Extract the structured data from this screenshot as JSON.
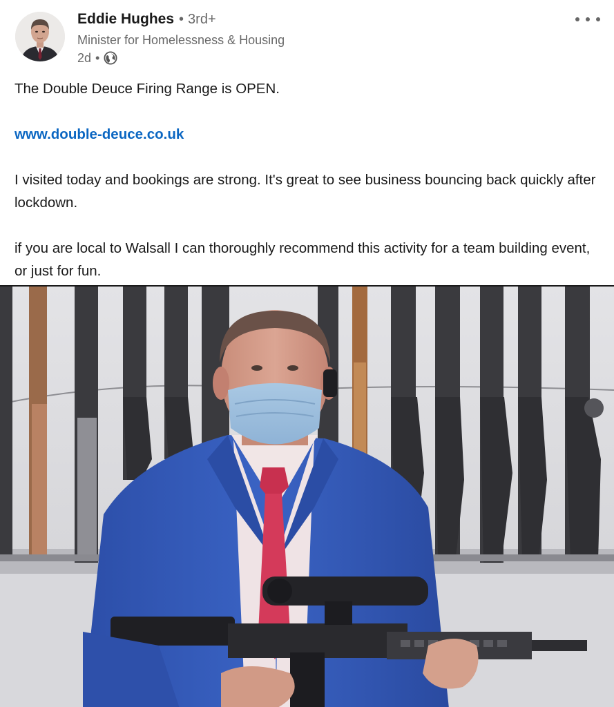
{
  "post": {
    "author": {
      "name": "Eddie Hughes",
      "degree": "3rd+",
      "headline": "Minister for Homelessness & Housing",
      "time": "2d",
      "visibility_icon": "globe-icon"
    },
    "menu_icon": "more-options-icon",
    "text": {
      "line1": "The Double Deuce Firing Range is OPEN.",
      "link": "www.double-deuce.co.uk",
      "para2": "I visited today and bookings are strong. It's great to see business bouncing back quickly after lockdown.",
      "para3": "if you are local to Walsall I can thoroughly recommend this activity for a team building event, or just for fun."
    }
  },
  "colors": {
    "link": "#0a66c2",
    "secondary_text": "#666666",
    "primary_text": "#1a1a1a"
  }
}
